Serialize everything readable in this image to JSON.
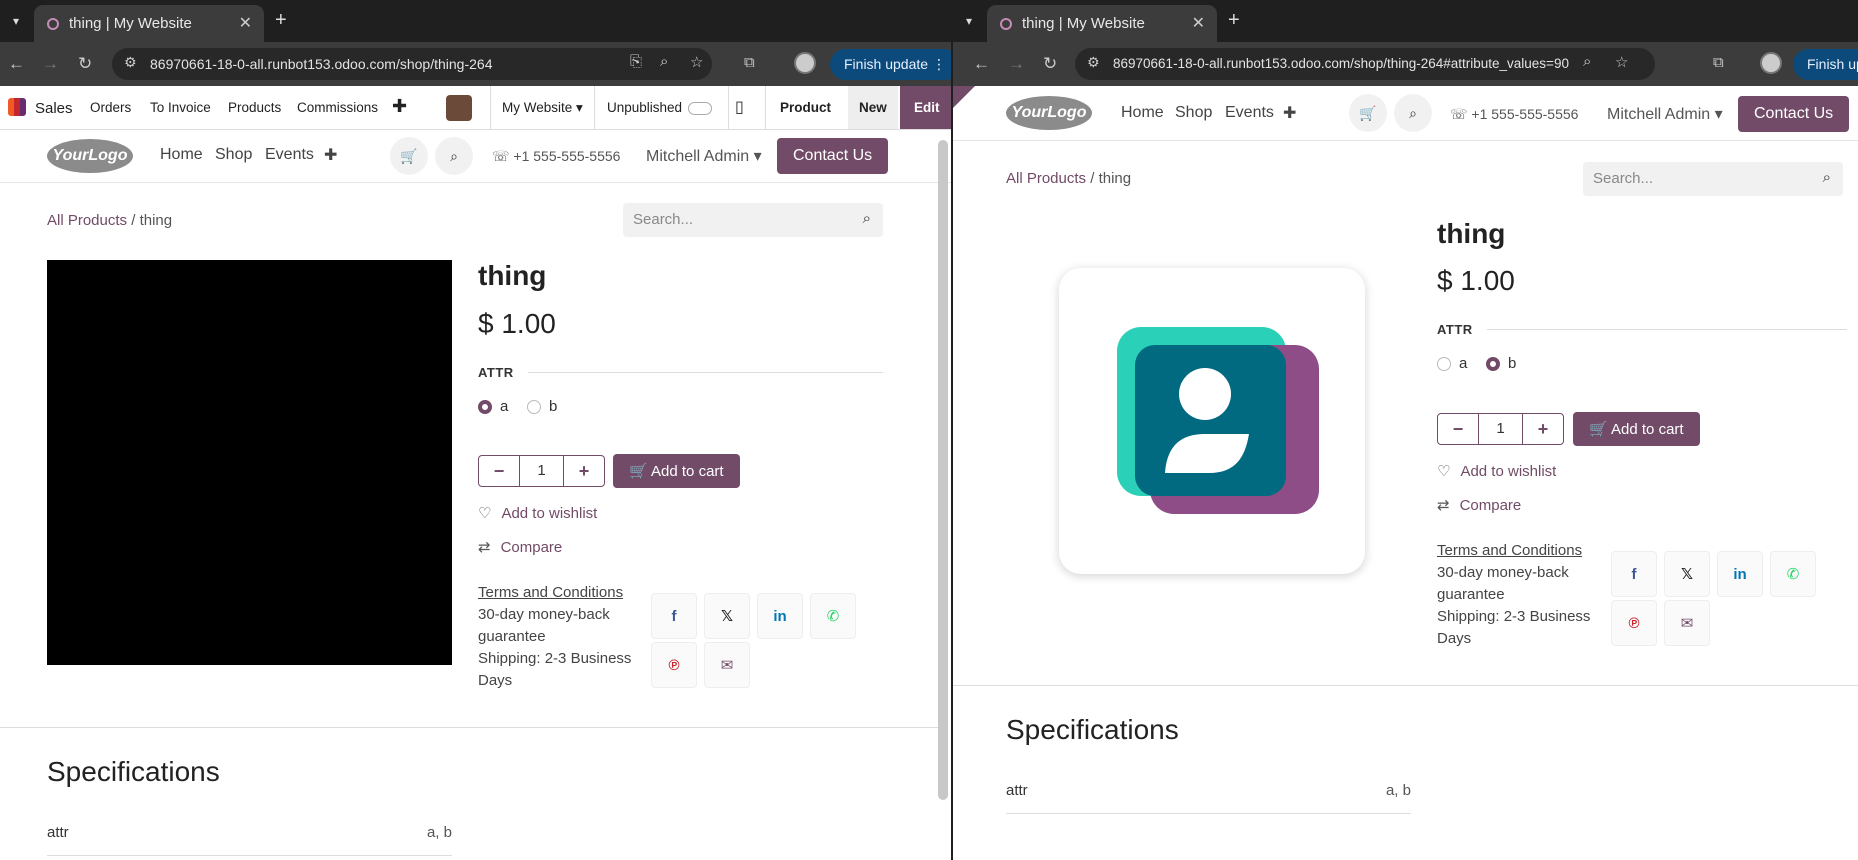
{
  "left": {
    "tab_title": "thing | My Website",
    "url": "86970661-18-0-all.runbot153.odoo.com/shop/thing-264",
    "finish_update": "Finish update",
    "odoo_bar": {
      "app": "Sales",
      "menus": [
        "Orders",
        "To Invoice",
        "Products",
        "Commissions"
      ],
      "website": "My Website",
      "published": "Unpublished",
      "product": "Product",
      "new": "New",
      "edit": "Edit"
    }
  },
  "right": {
    "tab_title": "thing | My Website",
    "url": "86970661-18-0-all.runbot153.odoo.com/shop/thing-264#attribute_values=90",
    "finish_update": "Finish upd"
  },
  "site": {
    "logo": "YourLogo",
    "nav": [
      "Home",
      "Shop",
      "Events"
    ],
    "phone": "+1 555-555-5556",
    "user": "Mitchell Admin",
    "contact": "Contact Us",
    "search_placeholder": "Search..."
  },
  "product": {
    "breadcrumb_root": "All Products",
    "breadcrumb_sep": "/",
    "breadcrumb_current": "thing",
    "name": "thing",
    "price": "$ 1.00",
    "attribute": "ATTR",
    "options": [
      "a",
      "b"
    ],
    "left_selected": "a",
    "right_selected": "b",
    "quantity": "1",
    "add_to_cart": "Add to cart",
    "wishlist": "Add to wishlist",
    "compare": "Compare",
    "terms": "Terms and Conditions",
    "guarantee_1": "30-day money-back",
    "guarantee_2": "guarantee",
    "shipping_1": "Shipping: 2-3 Business",
    "shipping_2": "Days"
  },
  "specs": {
    "title": "Specifications",
    "row_name": "attr",
    "row_value": "a, b"
  },
  "colors": {
    "brand": "#714b67",
    "facebook": "#3b5998",
    "x": "#222222",
    "linkedin": "#0077b5",
    "whatsapp": "#25d366",
    "pinterest": "#c8232c",
    "email": "#714b67"
  }
}
